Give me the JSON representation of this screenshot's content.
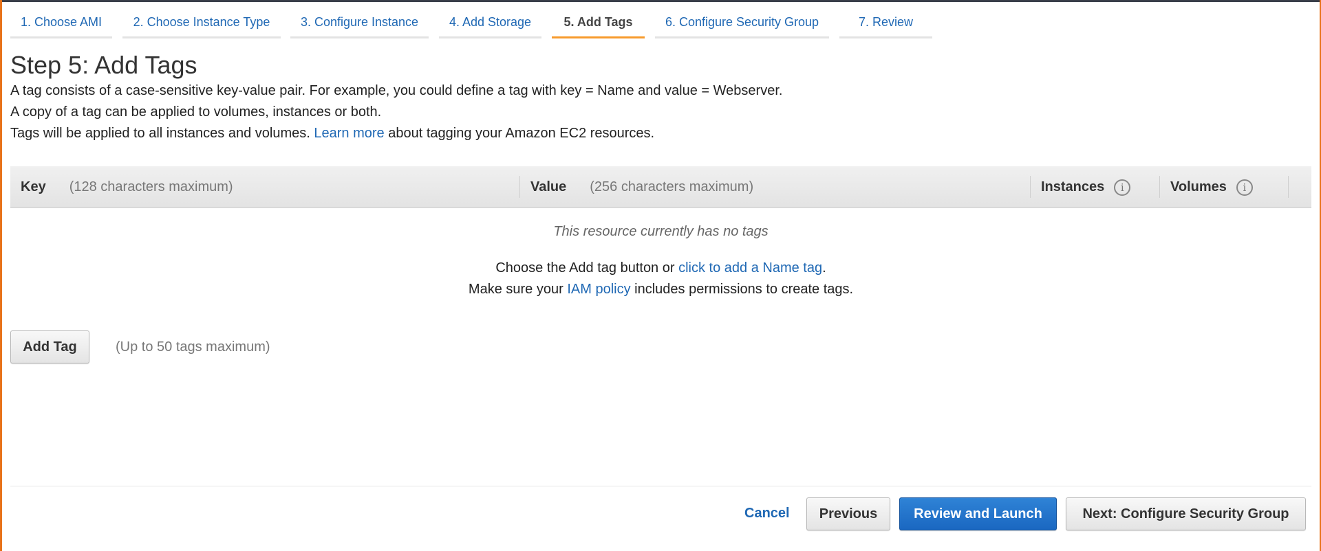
{
  "steps": [
    {
      "label": "1. Choose AMI",
      "active": false
    },
    {
      "label": "2. Choose Instance Type",
      "active": false
    },
    {
      "label": "3. Configure Instance",
      "active": false
    },
    {
      "label": "4. Add Storage",
      "active": false
    },
    {
      "label": "5. Add Tags",
      "active": true
    },
    {
      "label": "6. Configure Security Group",
      "active": false
    },
    {
      "label": "7. Review",
      "active": false
    }
  ],
  "page": {
    "title": "Step 5: Add Tags",
    "desc_line1": "A tag consists of a case-sensitive key-value pair. For example, you could define a tag with key = Name and value = Webserver.",
    "desc_line2": "A copy of a tag can be applied to volumes, instances or both.",
    "desc_line3_pre": "Tags will be applied to all instances and volumes.",
    "desc_line3_link": "Learn more",
    "desc_line3_post": "about tagging your Amazon EC2 resources."
  },
  "table": {
    "key_label": "Key",
    "key_hint": "(128 characters maximum)",
    "value_label": "Value",
    "value_hint": "(256 characters maximum)",
    "instances_label": "Instances",
    "volumes_label": "Volumes",
    "info_glyph": "i"
  },
  "empty_state": {
    "message": "This resource currently has no tags",
    "line1_pre": "Choose the Add tag button or",
    "line1_link": "click to add a Name tag",
    "line1_post": ".",
    "line2_pre": "Make sure your",
    "line2_link": "IAM policy",
    "line2_post": "includes permissions to create tags."
  },
  "add_tag": {
    "button_label": "Add Tag",
    "hint": "(Up to 50 tags maximum)"
  },
  "footer": {
    "cancel": "Cancel",
    "previous": "Previous",
    "review_launch": "Review and Launch",
    "next": "Next: Configure Security Group"
  },
  "colors": {
    "link": "#1f68b4",
    "active_tab_underline": "#f79a2c",
    "primary_button": "#1a67c1",
    "frame_accent": "#e8731b"
  }
}
